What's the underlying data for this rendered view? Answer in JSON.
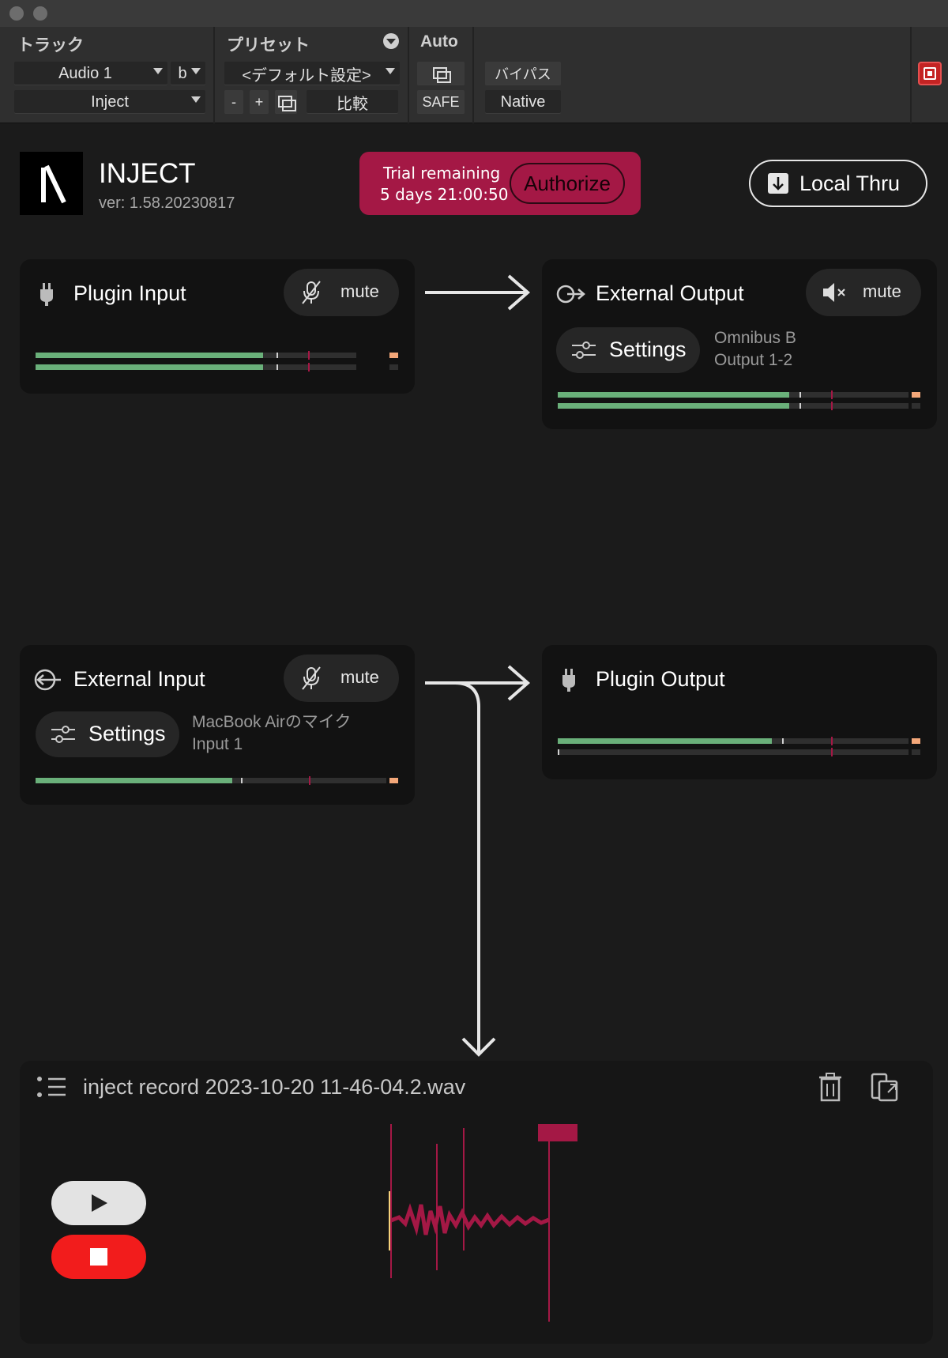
{
  "host": {
    "track_header": "トラック",
    "preset_header": "プリセット",
    "auto_header": "Auto",
    "track_name": "Audio 1",
    "track_variant": "b",
    "insert_name": "Inject",
    "preset_name": "<デフォルト設定>",
    "minus_label": "-",
    "plus_label": "+",
    "compare_label": "比較",
    "safe_label": "SAFE",
    "bypass_label": "バイパス",
    "native_label": "Native"
  },
  "plugin": {
    "name": "INJECT",
    "version": "ver: 1.58.20230817",
    "trial_line1": "Trial remaining",
    "trial_line2": "5 days 21:00:50",
    "authorize_label": "Authorize",
    "local_thru_label": "Local Thru"
  },
  "plugin_input": {
    "title": "Plugin Input",
    "mute_label": "mute",
    "meters": [
      0.71,
      0.71
    ]
  },
  "external_output": {
    "title": "External Output",
    "mute_label": "mute",
    "settings_label": "Settings",
    "device_line1": "Omnibus B",
    "device_line2": "Output 1-2",
    "meters": [
      0.72,
      0.72
    ]
  },
  "external_input": {
    "title": "External Input",
    "mute_label": "mute",
    "settings_label": "Settings",
    "device_line1": "MacBook Airのマイク",
    "device_line2": "Input 1",
    "meters": [
      0.61
    ]
  },
  "plugin_output": {
    "title": "Plugin Output",
    "meters": [
      0.61,
      0.0
    ]
  },
  "recorder": {
    "filename": "inject record 2023-10-20 11-46-04.2.wav"
  },
  "colors": {
    "accent": "#a41845",
    "meter_green": "#6ab07a",
    "clip_orange": "#f3a779",
    "stop_red": "#f21c1c"
  }
}
